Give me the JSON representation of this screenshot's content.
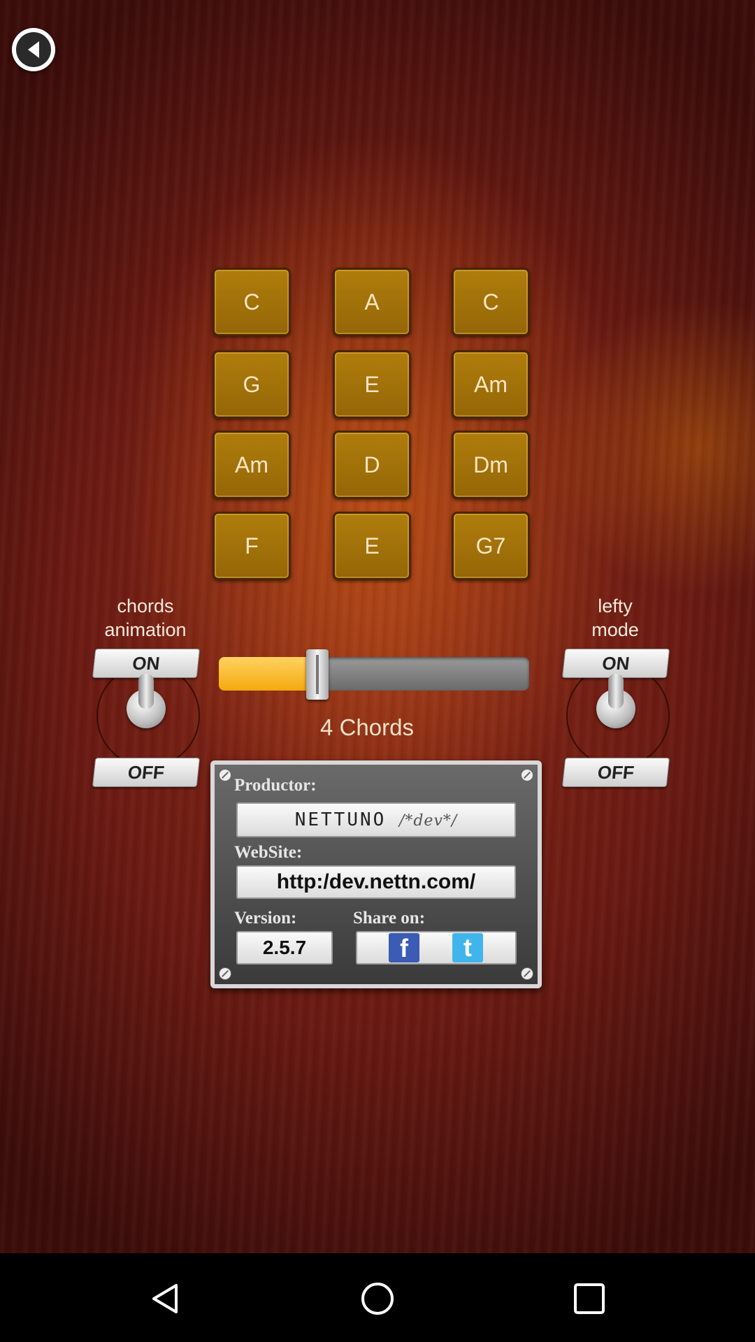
{
  "chords": {
    "rows": [
      [
        "C",
        "A",
        "C"
      ],
      [
        "G",
        "E",
        "Am"
      ],
      [
        "Am",
        "D",
        "Dm"
      ],
      [
        "F",
        "E",
        "G7"
      ]
    ]
  },
  "left_toggle": {
    "label_line1": "chords",
    "label_line2": "animation",
    "on_label": "ON",
    "off_label": "OFF"
  },
  "right_toggle": {
    "label_line1": "lefty",
    "label_line2": "mode",
    "on_label": "ON",
    "off_label": "OFF"
  },
  "slider": {
    "value_fraction": 0.3,
    "caption": "4 Chords"
  },
  "info": {
    "productor_label": "Productor:",
    "brand_name": "NETTUNO",
    "brand_suffix": "/*dev*/",
    "website_label": "WebSite:",
    "website_url": "http:/dev.nettn.com/",
    "version_label": "Version:",
    "version_value": "2.5.7",
    "share_label": "Share on:"
  },
  "icons": {
    "back": "back-arrow-icon",
    "facebook": "facebook-icon",
    "twitter": "twitter-icon"
  },
  "colors": {
    "chord_button": "#a1700a",
    "slider_fill": "#f4a90e"
  }
}
